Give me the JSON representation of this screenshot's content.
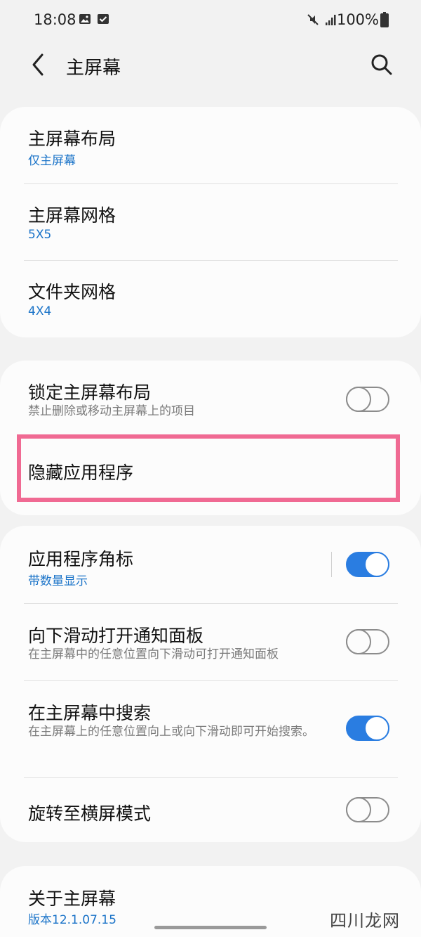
{
  "status_bar": {
    "time": "18:08",
    "battery_text": "100%"
  },
  "header": {
    "title": "主屏幕"
  },
  "group1": {
    "items": [
      {
        "title": "主屏幕布局",
        "subtitle": "仅主屏幕"
      },
      {
        "title": "主屏幕网格",
        "subtitle": "5X5"
      },
      {
        "title": "文件夹网格",
        "subtitle": "4X4"
      }
    ]
  },
  "group2": {
    "lock_layout": {
      "title": "锁定主屏幕布局",
      "description": "禁止删除或移动主屏幕上的项目",
      "enabled": false
    },
    "hide_apps": {
      "title": "隐藏应用程序"
    }
  },
  "group3": {
    "badges": {
      "title": "应用程序角标",
      "subtitle": "带数量显示",
      "enabled": true
    },
    "swipe_notif": {
      "title": "向下滑动打开通知面板",
      "description": "在主屏幕中的任意位置向下滑动可打开通知面板",
      "enabled": false
    },
    "search": {
      "title": "在主屏幕中搜索",
      "description": "在主屏幕上的任意位置向上或向下滑动即可开始搜索。",
      "enabled": true
    },
    "rotate": {
      "title": "旋转至横屏模式",
      "enabled": false
    }
  },
  "group4": {
    "about": {
      "title": "关于主屏幕",
      "version": "版本12.1.07.15"
    }
  },
  "watermark": "四川龙网",
  "colors": {
    "accent": "#2a7de1",
    "link": "#1a73c8",
    "highlight": "#f06a93",
    "background": "#f2f2f2",
    "card": "#fcfcfc"
  }
}
